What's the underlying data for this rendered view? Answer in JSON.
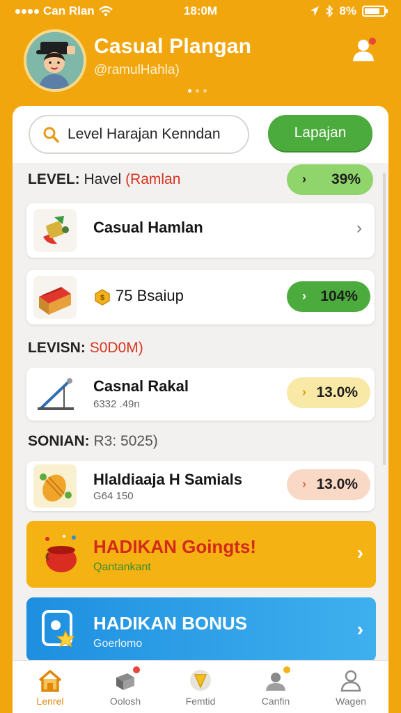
{
  "status_bar": {
    "carrier": "Can Rlan",
    "time": "18:0M",
    "battery": "8%",
    "battery_level": 0.8
  },
  "header": {
    "title": "Casual Plangan",
    "handle": "@ramulHahla)",
    "icons": {
      "avatar": "avatar-image",
      "profile": "user-icon"
    }
  },
  "search": {
    "value": "Level Harajan Kenndan",
    "placeholder": "Level Harajan Kenndan",
    "button_label": "Lapajan"
  },
  "level_header": {
    "prefix": "LEVEL:",
    "name": "Havel",
    "highlight": "(Ramlan",
    "percent": "39%"
  },
  "rows": [
    {
      "title": "Casual Hamlan",
      "icon": "rocket-icon"
    },
    {
      "value": "75 Bsaiup",
      "icon": "treasure-box-icon",
      "coin_icon": "coin-icon",
      "percent": "104%"
    }
  ],
  "section2": {
    "label": "LEVISN:",
    "value": "S0D0M)"
  },
  "row3": {
    "title": "Casnal Rakal",
    "sub": "6332 .49n",
    "percent": "13.0%",
    "icon": "crane-icon"
  },
  "section3": {
    "label": "SONIAN:",
    "value": "R3: 5025)"
  },
  "row4": {
    "title": "Hlaldiaaja H Samials",
    "sub": "G64 150",
    "percent": "13.0%",
    "icon": "drum-icon"
  },
  "promo1": {
    "title": "HADIKAN Goingts!",
    "sub": "Qantankant",
    "icon": "pot-icon"
  },
  "promo2": {
    "title": "HADIKAN BONUS",
    "sub": "Goerlomo",
    "icon": "bonus-card-icon"
  },
  "nav": [
    {
      "label": "Lenrel",
      "icon": "home-icon",
      "active": true
    },
    {
      "label": "Oolosh",
      "icon": "box-icon",
      "active": false
    },
    {
      "label": "Femtid",
      "icon": "badge-icon",
      "active": false
    },
    {
      "label": "Canfin",
      "icon": "group-icon",
      "active": false
    },
    {
      "label": "Wagen",
      "icon": "person-icon",
      "active": false
    }
  ],
  "colors": {
    "background": "#F2A60E",
    "green": "#4cab3d",
    "red_text": "#d6331f",
    "promo_yellow": "#F4B213",
    "promo_blue": "#2aa0e6"
  }
}
